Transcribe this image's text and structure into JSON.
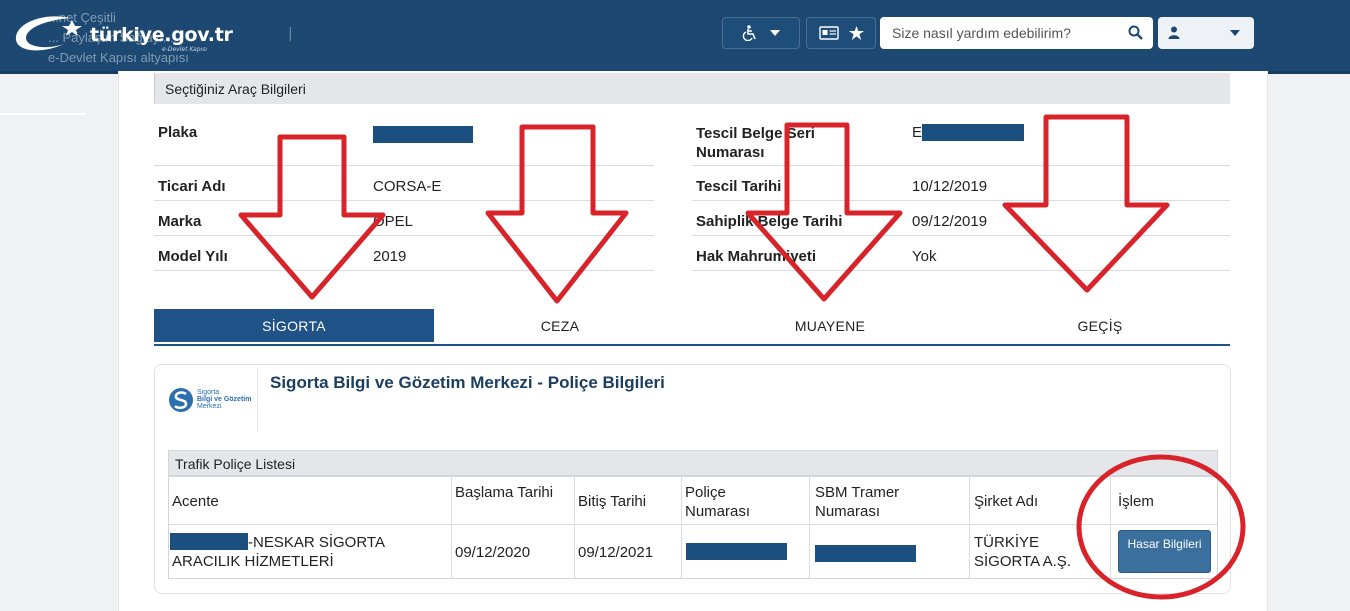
{
  "header": {
    "logo_text": "türkiye.gov.tr",
    "logo_subtext": "e-Devlet Kapısı",
    "ghost_lines": [
      "...net Çeşitli",
      "... Paylaşım Sağlayı...",
      "e-Devlet Kapısı altyapısı"
    ],
    "search_placeholder": "Size nasıl yardım edebilirim?",
    "icons": [
      "accessibility-icon",
      "id-card-icon",
      "star-icon",
      "search-icon",
      "user-icon",
      "chevron-down-icon"
    ]
  },
  "vehicle": {
    "title": "Seçtiğiniz Araç Bilgileri",
    "left_fields": [
      {
        "label": "Plaka",
        "value": ""
      },
      {
        "label": "Ticari Adı",
        "value": "CORSA-E"
      },
      {
        "label": "Marka",
        "value": "OPEL"
      },
      {
        "label": "Model Yılı",
        "value": "2019"
      }
    ],
    "right_fields": [
      {
        "label": "Tescil Belge Seri Numarası",
        "value": "E"
      },
      {
        "label": "Tescil Tarihi",
        "value": "10/12/2019"
      },
      {
        "label": "Sahiplik Belge Tarihi",
        "value": "09/12/2019"
      },
      {
        "label": "Hak Mahrumiyeti",
        "value": "Yok"
      }
    ]
  },
  "tabs": [
    {
      "label": "SİGORTA",
      "active": true
    },
    {
      "label": "CEZA",
      "active": false
    },
    {
      "label": "MUAYENE",
      "active": false
    },
    {
      "label": "GEÇİŞ",
      "active": false
    }
  ],
  "sbm": {
    "logo_lines": [
      "Sigorta",
      "Bilgi ve Gözetim",
      "Merkezi"
    ],
    "title": "Sigorta Bilgi ve Gözetim Merkezi - Poliçe Bilgileri",
    "table_title": "Trafik Poliçe Listesi",
    "columns": [
      "Acente",
      "Başlama Tarihi",
      "Bitiş Tarihi",
      "Poliçe Numarası",
      "SBM Tramer Numarası",
      "Şirket Adı",
      "İşlem"
    ],
    "rows": [
      {
        "acente": "-NESKAR SİGORTA ARACILIK HİZMETLERİ",
        "baslama": "09/12/2020",
        "bitis": "09/12/2021",
        "police_no": "",
        "tramer_no": "",
        "sirket": "TÜRKİYE SİGORTA A.Ş.",
        "islem": "Hasar Bilgileri"
      }
    ]
  },
  "colors": {
    "header_bg": "#1c4872",
    "tab_active": "#1f5387",
    "redaction": "#1b4f80",
    "annotation_red": "#d8232a",
    "button": "#3a6f9e"
  }
}
